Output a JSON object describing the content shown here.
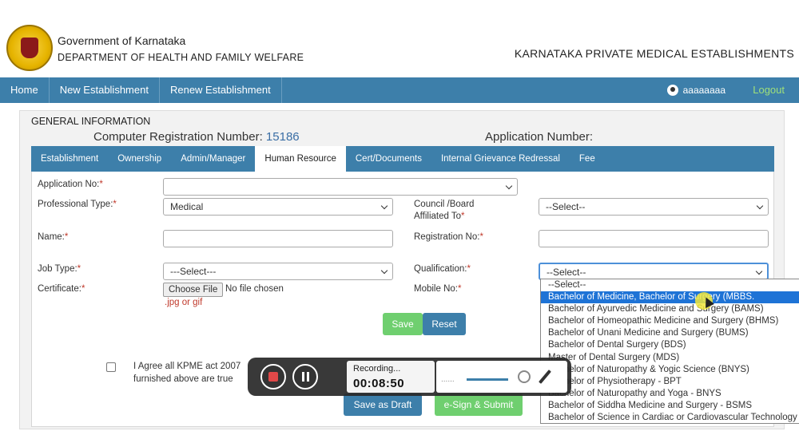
{
  "header": {
    "gov_title": "Government of Karnataka",
    "dept_title": "DEPARTMENT OF HEALTH AND FAMILY WELFARE",
    "app_title": "KARNATAKA PRIVATE MEDICAL ESTABLISHMENTS"
  },
  "nav": {
    "home": "Home",
    "new_establishment": "New Establishment",
    "renew_establishment": "Renew Establishment",
    "user": "aaaaaaaa",
    "logout": "Logout"
  },
  "panel": {
    "title": "GENERAL INFORMATION",
    "reg_label": "Computer Registration Number: ",
    "reg_value": "15186",
    "app_number_label": "Application Number:"
  },
  "tabs": [
    {
      "label": "Establishment"
    },
    {
      "label": "Ownership"
    },
    {
      "label": "Admin/Manager"
    },
    {
      "label": "Human Resource"
    },
    {
      "label": "Cert/Documents"
    },
    {
      "label": "Internal Grievance Redressal"
    },
    {
      "label": "Fee"
    }
  ],
  "form": {
    "application_no_label": "Application No:",
    "application_no_value": "",
    "professional_type_label": "Professional Type:",
    "professional_type_value": "Medical",
    "council_label_line1": "Council /Board",
    "council_label_line2": "Affiliated To",
    "council_value": "--Select--",
    "name_label": "Name:",
    "registration_no_label": "Registration No:",
    "job_type_label": "Job Type:",
    "job_type_value": "---Select---",
    "qualification_label": "Qualification:",
    "qualification_value": "--Select--",
    "certificate_label": "Certificate:",
    "choose_file": "Choose File",
    "no_file": "No file chosen",
    "file_hint": ".jpg or gif",
    "mobile_label": "Mobile No:",
    "required_mark": "*",
    "save": "Save",
    "reset": "Reset",
    "agree_line1": "I Agree all KPME act 2007",
    "agree_line2": "furnished above are true",
    "save_draft": "Save as Draft",
    "esign_submit": "e-Sign & Submit"
  },
  "qualification_options": [
    "--Select--",
    "Bachelor of Medicine, Bachelor of Surgery (MBBS.",
    "Bachelor of Ayurvedic Medicine and Surgery (BAMS)",
    "Bachelor of Homeopathic Medicine and Surgery (BHMS)",
    "Bachelor of Unani Medicine and Surgery (BUMS)",
    "Bachelor of Dental Surgery (BDS)",
    "Master of Dental Surgery (MDS)",
    "Bachelor of Naturopathy & Yogic Science (BNYS)",
    "Bachelor of Physiotherapy - BPT",
    "Bachelor of Naturopathy and Yoga - BNYS",
    "Bachelor of Siddha Medicine and Surgery - BSMS",
    "Bachelor of Science in Cardiac or Cardiovascular Technology"
  ],
  "qualification_selected_index": 1,
  "recording": {
    "label": "Recording...",
    "time": "00:08:50",
    "dots": "......"
  }
}
